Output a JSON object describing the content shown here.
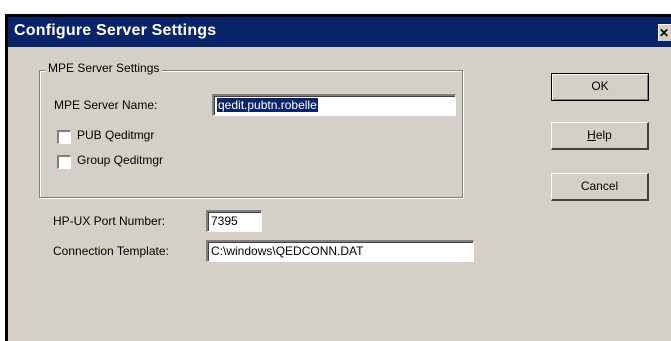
{
  "window": {
    "title": "Configure Server Settings",
    "close_glyph": "✕"
  },
  "mpe_group": {
    "legend": "MPE Server Settings",
    "server_name_label": "MPE Server Name:",
    "server_name_value": "qedit.pubtn.robelle",
    "pub_qeditmgr_label": "PUB Qeditmgr",
    "pub_qeditmgr_checked": false,
    "group_qeditmgr_label": "Group Qeditmgr",
    "group_qeditmgr_checked": false
  },
  "port": {
    "label": "HP-UX Port Number:",
    "value": "7395"
  },
  "template": {
    "label": "Connection Template:",
    "value": "C:\\windows\\QEDCONN.DAT"
  },
  "buttons": {
    "ok": "OK",
    "help_first": "H",
    "help_rest": "elp",
    "cancel": "Cancel"
  },
  "colors": {
    "titlebar": "#0a246a",
    "dialog_face": "#d4d0c8",
    "selection": "#0a246a"
  }
}
